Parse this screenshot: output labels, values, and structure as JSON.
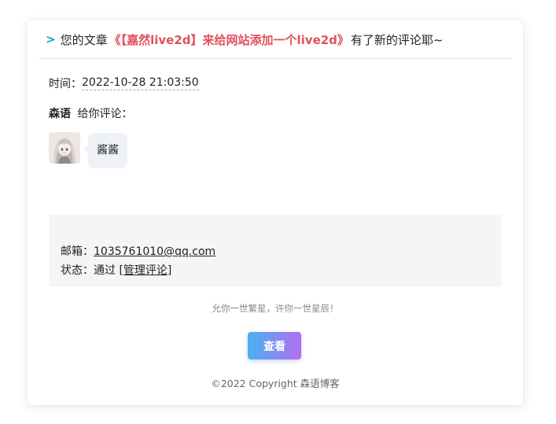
{
  "header": {
    "caret": ">",
    "prefix": "您的文章",
    "article_title": "《【嘉然live2d】来给网站添加一个live2d》",
    "suffix": "有了新的评论耶~"
  },
  "time": {
    "label": "时间：",
    "value": "2022-10-28 21:03:50"
  },
  "comment": {
    "author": "森语",
    "action": "给你评论：",
    "avatar_icon": "anime-girl-avatar",
    "text": "酱酱"
  },
  "info": {
    "email_label": "邮箱：",
    "email": "1035761010@qq.com",
    "status_label": "状态：",
    "status": "通过",
    "manage_bracket_open": "[",
    "manage_link": "管理评论",
    "manage_bracket_close": "]"
  },
  "motto": "允你一世繁星，许你一世星辰！",
  "view_button": "查看",
  "footer": "©2022 Copyright 森语博客",
  "colors": {
    "caret": "#12a6b6",
    "article_title": "#e2505d",
    "button_gradient_start": "#47b2f0",
    "button_gradient_end": "#b26ef0"
  }
}
